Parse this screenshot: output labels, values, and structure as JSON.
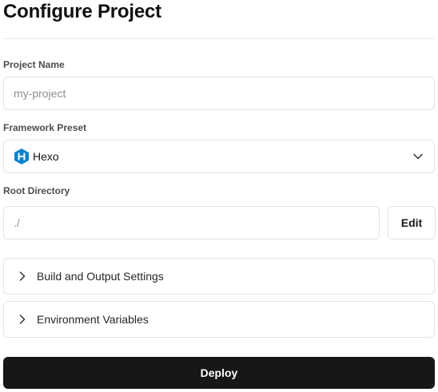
{
  "page": {
    "title": "Configure Project"
  },
  "project_name": {
    "label": "Project Name",
    "placeholder": "my-project",
    "value": ""
  },
  "framework_preset": {
    "label": "Framework Preset",
    "selected": "Hexo",
    "icon": "hexo-icon",
    "icon_color": "#0e83cd"
  },
  "root_directory": {
    "label": "Root Directory",
    "value": "./",
    "edit_label": "Edit"
  },
  "sections": {
    "build_output": "Build and Output Settings",
    "env_vars": "Environment Variables"
  },
  "deploy": {
    "label": "Deploy",
    "color": "#171717"
  }
}
